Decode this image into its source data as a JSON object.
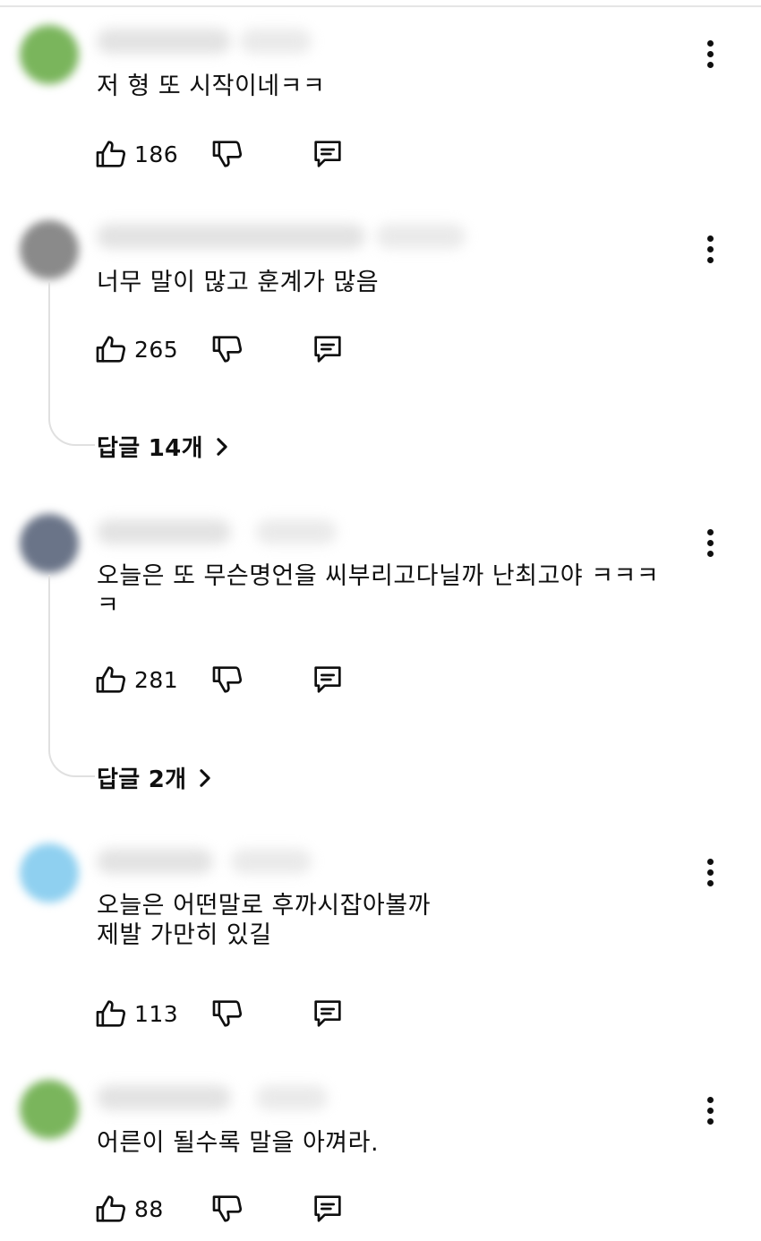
{
  "comments": [
    {
      "text": "저 형 또 시작이네ㅋㅋ",
      "likes": "186",
      "avatar_color": "#7ab55c"
    },
    {
      "text": "너무 말이 많고 훈계가 많음",
      "likes": "265",
      "avatar_color": "#8a8a8a",
      "replies_label": "답글 14개"
    },
    {
      "text": "오늘은 또 무슨명언을 씨부리고다닐까 난최고야 ㅋㅋㅋ\nㅋ",
      "likes": "281",
      "avatar_color": "#6a7488",
      "replies_label": "답글 2개"
    },
    {
      "text": "오늘은 어떤말로 후까시잡아볼까\n제발 가만히 있길",
      "likes": "113",
      "avatar_color": "#8fd0f0"
    },
    {
      "text": "어른이 될수록 말을 아껴라.",
      "likes": "88",
      "avatar_color": "#7ab55c"
    }
  ],
  "icons": {
    "like": "thumbs-up-icon",
    "dislike": "thumbs-down-icon",
    "reply": "reply-icon",
    "more": "more-vertical-icon",
    "replies_arrow": "chevron-right-icon"
  }
}
